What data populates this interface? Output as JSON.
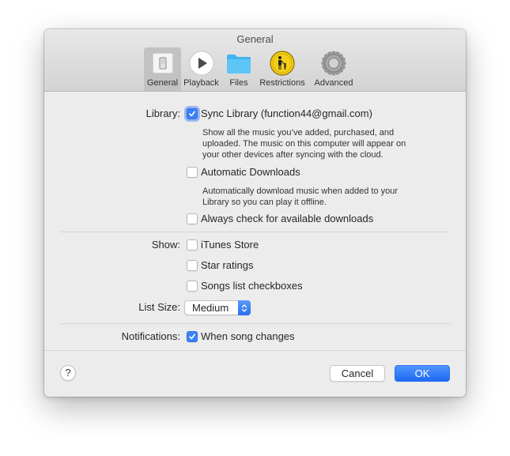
{
  "window": {
    "title": "General"
  },
  "toolbar": {
    "items": [
      {
        "label": "General",
        "icon": "general-switch-icon",
        "active": true
      },
      {
        "label": "Playback",
        "icon": "play-icon",
        "active": false
      },
      {
        "label": "Files",
        "icon": "folder-icon",
        "active": false
      },
      {
        "label": "Restrictions",
        "icon": "parental-restrictions-icon",
        "active": false
      },
      {
        "label": "Advanced",
        "icon": "gear-icon",
        "active": false
      }
    ]
  },
  "library": {
    "label": "Library:",
    "sync_library": {
      "label": "Sync Library (function44@gmail.com)",
      "checked": true
    },
    "sync_description": [
      "Show all the music you’ve added, purchased, and",
      "uploaded. The music on this computer will appear on",
      "your other devices after syncing with the cloud."
    ],
    "automatic_downloads": {
      "label": "Automatic Downloads",
      "checked": false
    },
    "automatic_description": [
      "Automatically download music when added to your",
      "Library so you can play it offline."
    ],
    "always_check": {
      "label": "Always check for available downloads",
      "checked": false
    }
  },
  "show": {
    "label": "Show:",
    "itunes_store": {
      "label": "iTunes Store",
      "checked": false
    },
    "star_ratings": {
      "label": "Star ratings",
      "checked": false
    },
    "songs_list_checkboxes": {
      "label": "Songs list checkboxes",
      "checked": false
    }
  },
  "list_size": {
    "label": "List Size:",
    "value": "Medium"
  },
  "notifications": {
    "label": "Notifications:",
    "when_song_changes": {
      "label": "When song changes",
      "checked": true
    }
  },
  "footer": {
    "help": "?",
    "cancel": "Cancel",
    "ok": "OK"
  },
  "colors": {
    "accent": "#3b82f6",
    "window_bg": "#ececec"
  }
}
